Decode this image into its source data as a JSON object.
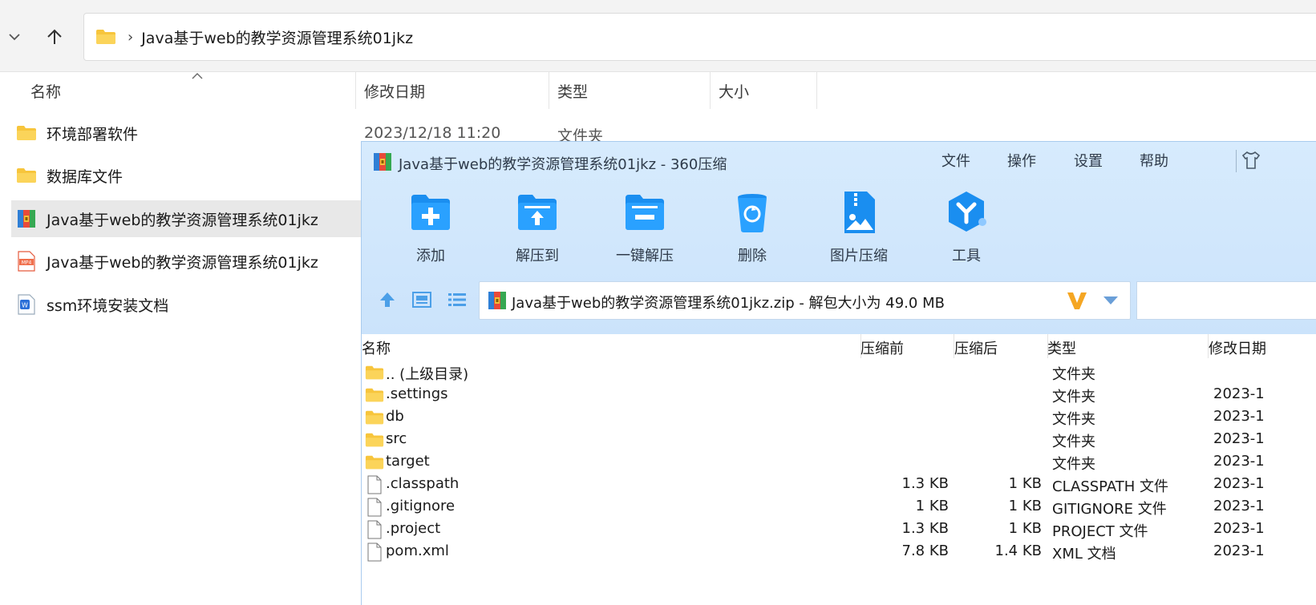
{
  "explorer": {
    "address": {
      "path": "Java基于web的教学资源管理系统01jkz",
      "separator": "›"
    },
    "columns": {
      "name": "名称",
      "modified": "修改日期",
      "type": "类型",
      "size": "大小"
    },
    "items": [
      {
        "name": "环境部署软件",
        "icon": "folder-icon",
        "modified": "2023/12/18 11:20",
        "type": "文件夹"
      },
      {
        "name": "数据库文件",
        "icon": "folder-icon"
      },
      {
        "name": "Java基于web的教学资源管理系统01jkz",
        "icon": "zip-archive-icon",
        "selected": true
      },
      {
        "name": "Java基于web的教学资源管理系统01jkz",
        "icon": "mp4-file-icon"
      },
      {
        "name": "ssm环境安装文档",
        "icon": "word-doc-icon"
      }
    ]
  },
  "zip": {
    "title": "Java基于web的教学资源管理系统01jkz - 360压缩",
    "menu": {
      "file": "文件",
      "operate": "操作",
      "settings": "设置",
      "help": "帮助"
    },
    "toolbar": {
      "add": "添加",
      "extract_to": "解压到",
      "one_click_extract": "一键解压",
      "delete": "删除",
      "image_compress": "图片压缩",
      "tools": "工具"
    },
    "path": "Java基于web的教学资源管理系统01jkz.zip - 解包大小为 49.0 MB",
    "columns": {
      "name": "名称",
      "before": "压缩前",
      "after": "压缩后",
      "type": "类型",
      "modified": "修改日期"
    },
    "files": [
      {
        "name": ".. (上级目录)",
        "icon": "folder-icon",
        "before": "",
        "after": "",
        "type": "文件夹",
        "date": ""
      },
      {
        "name": ".settings",
        "icon": "folder-icon",
        "before": "",
        "after": "",
        "type": "文件夹",
        "date": "2023-1"
      },
      {
        "name": "db",
        "icon": "folder-icon",
        "before": "",
        "after": "",
        "type": "文件夹",
        "date": "2023-1"
      },
      {
        "name": "src",
        "icon": "folder-icon",
        "before": "",
        "after": "",
        "type": "文件夹",
        "date": "2023-1"
      },
      {
        "name": "target",
        "icon": "folder-icon",
        "before": "",
        "after": "",
        "type": "文件夹",
        "date": "2023-1"
      },
      {
        "name": ".classpath",
        "icon": "file-icon",
        "before": "1.3 KB",
        "after": "1 KB",
        "type": "CLASSPATH 文件",
        "date": "2023-1"
      },
      {
        "name": ".gitignore",
        "icon": "file-icon",
        "before": "1 KB",
        "after": "1 KB",
        "type": "GITIGNORE 文件",
        "date": "2023-1"
      },
      {
        "name": ".project",
        "icon": "file-icon",
        "before": "1.3 KB",
        "after": "1 KB",
        "type": "PROJECT 文件",
        "date": "2023-1"
      },
      {
        "name": "pom.xml",
        "icon": "file-icon",
        "before": "7.8 KB",
        "after": "1.4 KB",
        "type": "XML 文档",
        "date": "2023-1"
      }
    ]
  },
  "colors": {
    "accent": "#1e90ff",
    "zip_header": "#d4e9fc",
    "folder": "#f7c53c",
    "selected_row": "#e8e8e8"
  }
}
